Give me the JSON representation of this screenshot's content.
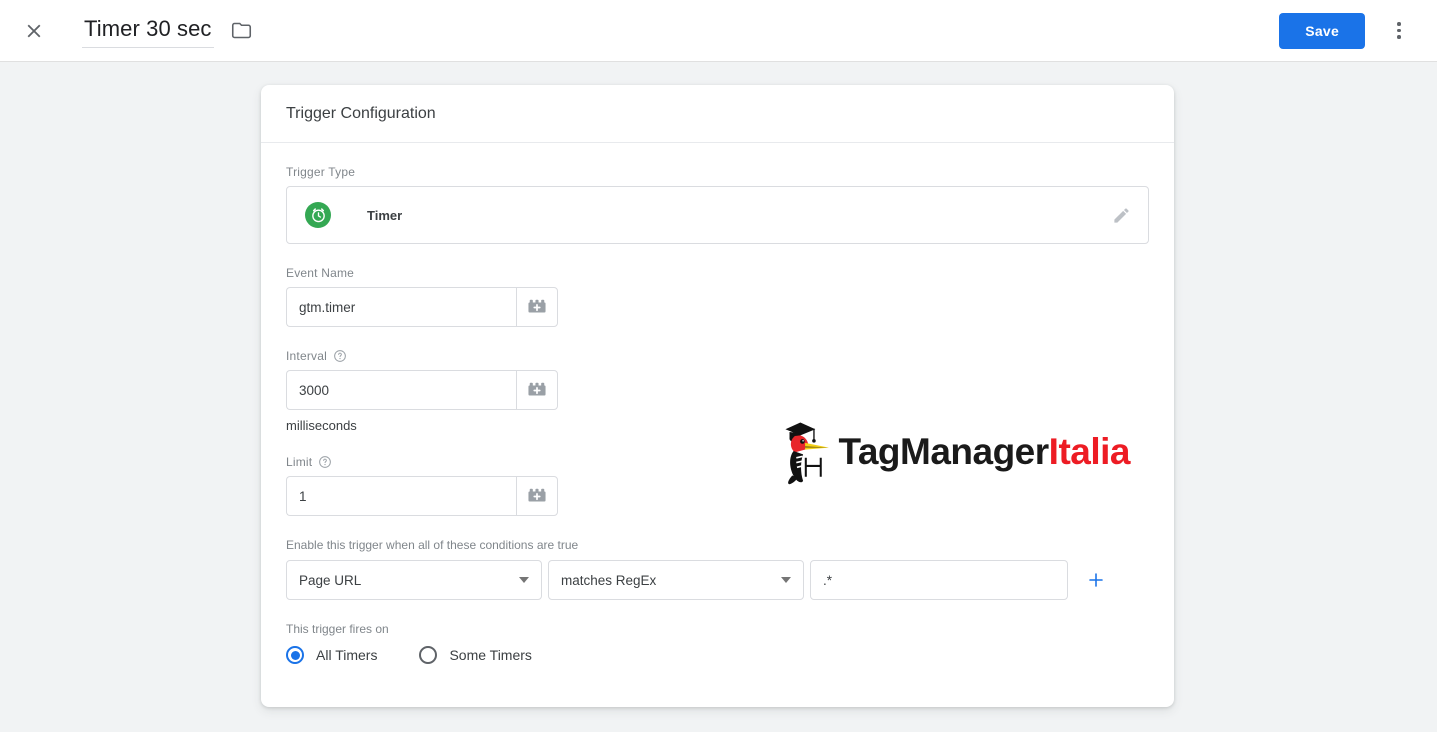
{
  "topbar": {
    "close_icon": "close-icon",
    "title": "Timer 30 sec",
    "folder_icon": "folder-icon",
    "save_label": "Save",
    "more_icon": "more-vert-icon"
  },
  "card": {
    "header_title": "Trigger Configuration",
    "trigger_type": {
      "label": "Trigger Type",
      "icon": "timer-icon",
      "name": "Timer",
      "edit_icon": "pencil-icon"
    },
    "event_name": {
      "label": "Event Name",
      "value": "gtm.timer",
      "variable_picker_icon": "lego-brick-plus-icon"
    },
    "interval": {
      "label": "Interval",
      "help_icon": "help-circle-icon",
      "value": "3000",
      "hint": "milliseconds",
      "variable_picker_icon": "lego-brick-plus-icon"
    },
    "limit": {
      "label": "Limit",
      "help_icon": "help-circle-icon",
      "value": "1",
      "variable_picker_icon": "lego-brick-plus-icon"
    },
    "conditions": {
      "label": "Enable this trigger when all of these conditions are true",
      "variable": "Page URL",
      "operator": "matches RegEx",
      "value": ".*",
      "add_icon": "plus-icon"
    },
    "fires_on": {
      "label": "This trigger fires on",
      "options": [
        {
          "label": "All Timers",
          "selected": true
        },
        {
          "label": "Some Timers",
          "selected": false
        }
      ]
    }
  },
  "logo": {
    "text_primary": "TagManager",
    "text_accent": "Italia",
    "mark": "woodpecker-graduate-icon",
    "accent_color": "#ed1c24"
  },
  "colors": {
    "brand_blue": "#1a73e8",
    "timer_green": "#34a853",
    "page_background": "#f1f3f4"
  }
}
